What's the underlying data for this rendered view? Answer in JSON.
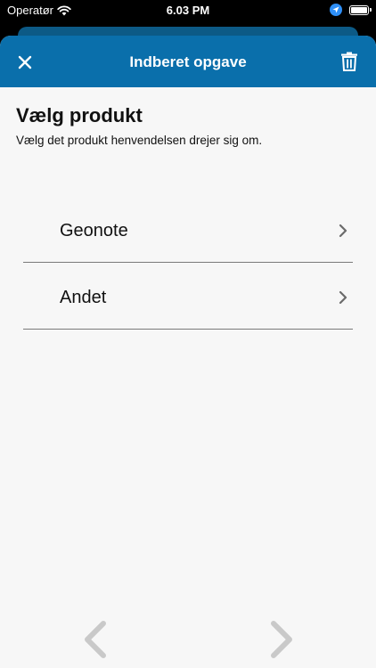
{
  "status_bar": {
    "carrier": "Operatør",
    "time": "6.03 PM",
    "battery_level": 1.0
  },
  "header": {
    "title": "Indberet opgave",
    "close_icon": "close-icon",
    "delete_icon": "trash-icon"
  },
  "content": {
    "title": "Vælg produkt",
    "subtitle": "Vælg det produkt henvendelsen drejer sig om."
  },
  "products": [
    {
      "label": "Geonote"
    },
    {
      "label": "Andet"
    }
  ],
  "footer": {
    "prev_icon": "chevron-left-icon",
    "next_icon": "chevron-right-icon"
  },
  "colors": {
    "header_bg": "#0a6fab",
    "sheet_bg": "#f7f7f7",
    "text": "#111111",
    "divider": "#7a7a7a",
    "chevron_small": "#6b6b6b",
    "chevron_large": "#c9c9c9"
  }
}
